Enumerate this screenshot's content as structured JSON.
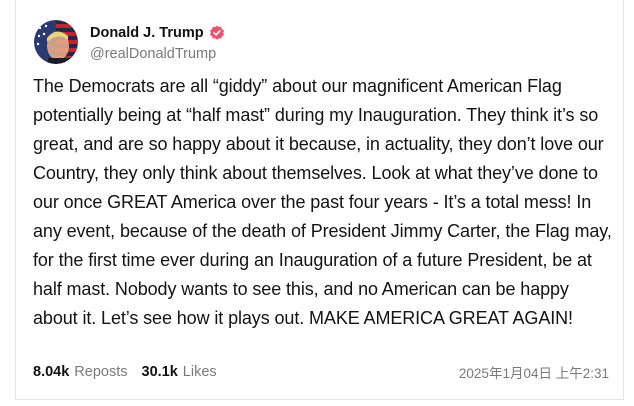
{
  "post": {
    "author": {
      "display_name": "Donald J. Trump",
      "handle": "@realDonaldTrump",
      "verified_icon": "verified-check-icon",
      "verified_color": "#f0506e"
    },
    "text": "The Democrats are all “giddy” about our magnificent American Flag potentially being at “half mast” during my Inauguration. They think it’s so great, and are so happy about it because, in actuality, they don’t love our Country, they only think about themselves. Look at what they’ve done to our once GREAT America over the past four years - It’s a total mess! In any event, because of the death of President Jimmy Carter, the Flag may, for the first time ever during an Inauguration of a future President, be at half mast. Nobody wants to see this, and no American can be happy about it. Let’s see how it plays out. MAKE AMERICA GREAT AGAIN!",
    "stats": {
      "reposts_count": "8.04k",
      "reposts_label": "Reposts",
      "likes_count": "30.1k",
      "likes_label": "Likes"
    },
    "timestamp": "2025年1月04日 上午2:31"
  }
}
